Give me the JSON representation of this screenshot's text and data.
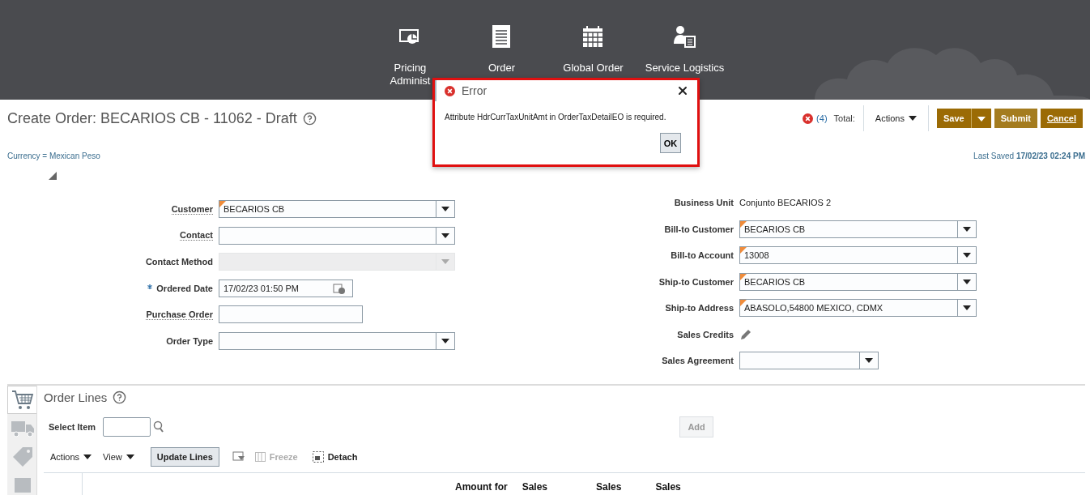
{
  "header": {
    "nav": [
      {
        "lines": [
          "Pricing",
          "Administ"
        ]
      },
      {
        "lines": [
          "Order"
        ]
      },
      {
        "lines": [
          "Global Order"
        ]
      },
      {
        "lines": [
          "Service Logistics"
        ]
      }
    ]
  },
  "page": {
    "title": "Create Order: BECARIOS CB - 11062 - Draft",
    "error_count": "(4)",
    "total_label": "Total:",
    "actions": "Actions",
    "buttons": [
      {
        "label": "Save",
        "kind": "split"
      },
      {
        "label": "Submit",
        "kind": "plain"
      },
      {
        "label": "Cancel",
        "kind": "plain"
      }
    ],
    "currency": "Currency = Mexican Peso",
    "last_saved_label": "Last Saved",
    "last_saved_value": "17/02/23 02:24 PM"
  },
  "form_left": [
    {
      "label": "Customer",
      "kind": "select",
      "value": "BECARIOS CB",
      "underlined": true,
      "flagged": true,
      "required": false,
      "disabled": false
    },
    {
      "label": "Contact",
      "kind": "select",
      "underlined": true,
      "flagged": false,
      "required": false,
      "disabled": false
    },
    {
      "label": "Contact Method",
      "kind": "select",
      "underlined": false,
      "flagged": false,
      "required": false,
      "disabled": true
    },
    {
      "label": "Ordered Date",
      "kind": "date",
      "value": "17/02/23 01:50 PM",
      "underlined": false,
      "flagged": false,
      "required": true,
      "disabled": false
    },
    {
      "label": "Purchase Order",
      "kind": "text",
      "underlined": true,
      "flagged": false,
      "required": false,
      "disabled": false
    },
    {
      "label": "Order Type",
      "kind": "select",
      "underlined": false,
      "flagged": false,
      "required": false,
      "disabled": false
    }
  ],
  "form_right": [
    {
      "label": "Business Unit",
      "kind": "readonly",
      "value": "Conjunto BECARIOS 2"
    },
    {
      "label": "Bill-to Customer",
      "kind": "select",
      "value": "BECARIOS CB",
      "flagged": true
    },
    {
      "label": "Bill-to Account",
      "kind": "select",
      "value": "13008",
      "flagged": true
    },
    {
      "label": "Ship-to Customer",
      "kind": "select",
      "value": "BECARIOS CB",
      "flagged": true
    },
    {
      "label": "Ship-to Address",
      "kind": "select",
      "value": "ABASOLO,54800  MEXICO, CDMX",
      "flagged": true
    },
    {
      "label": "Sales Credits",
      "kind": "edit"
    },
    {
      "label": "Sales Agreement",
      "kind": "combo",
      "flagged": false
    }
  ],
  "order_lines": {
    "title": "Order Lines",
    "side_tabs": [
      {
        "selected": true
      },
      {
        "selected": false
      },
      {
        "selected": false
      },
      {
        "selected": false
      }
    ],
    "select_item_label": "Select Item",
    "add": "Add",
    "toolbar": {
      "actions": "Actions",
      "view": "View",
      "update": "Update Lines",
      "freeze": "Freeze",
      "detach": "Detach"
    },
    "columns": [
      "Amount for",
      "Sales",
      "Sales",
      "Sales"
    ]
  },
  "dialog": {
    "title": "Error",
    "message": "Attribute HdrCurrTaxUnitAmt in OrderTaxDetailEO is required.",
    "ok": "OK"
  }
}
